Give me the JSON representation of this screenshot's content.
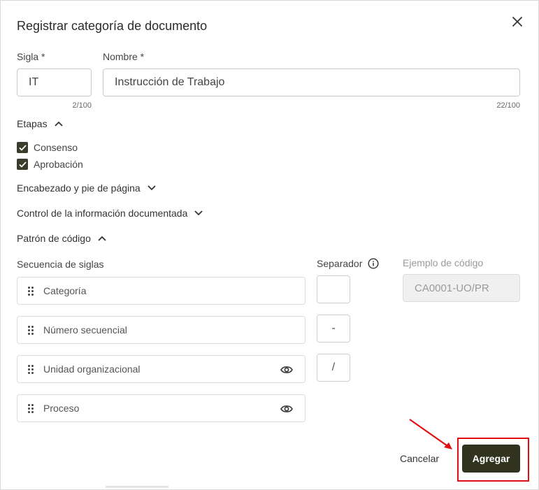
{
  "dialog": {
    "title": "Registrar categoría de documento",
    "close_icon": "close-icon"
  },
  "sigla": {
    "label": "Sigla *",
    "value": "IT",
    "counter": "2/100"
  },
  "nombre": {
    "label": "Nombre *",
    "value": "Instrucción de Trabajo",
    "counter": "22/100"
  },
  "etapas": {
    "label": "Etapas",
    "expanded": true,
    "items": [
      {
        "label": "Consenso",
        "checked": true
      },
      {
        "label": "Aprobación",
        "checked": true
      }
    ]
  },
  "sections": {
    "encabezado": "Encabezado y pie de página",
    "control": "Control de la información documentada",
    "patron": "Patrón de código"
  },
  "patron": {
    "sequence_label": "Secuencia de siglas",
    "separator_label": "Separador",
    "example_label": "Ejemplo de código",
    "example_value": "CA0001-UO/PR",
    "sequence": [
      {
        "label": "Categoría",
        "eye": false
      },
      {
        "label": "Número secuencial",
        "eye": false
      },
      {
        "label": "Unidad organizacional",
        "eye": true
      },
      {
        "label": "Proceso",
        "eye": true
      }
    ],
    "separators": [
      "",
      "-",
      "/"
    ]
  },
  "footer": {
    "cancel_label": "Cancelar",
    "add_label": "Agregar"
  },
  "colors": {
    "primary": "#32331f",
    "highlight": "#e01010"
  }
}
